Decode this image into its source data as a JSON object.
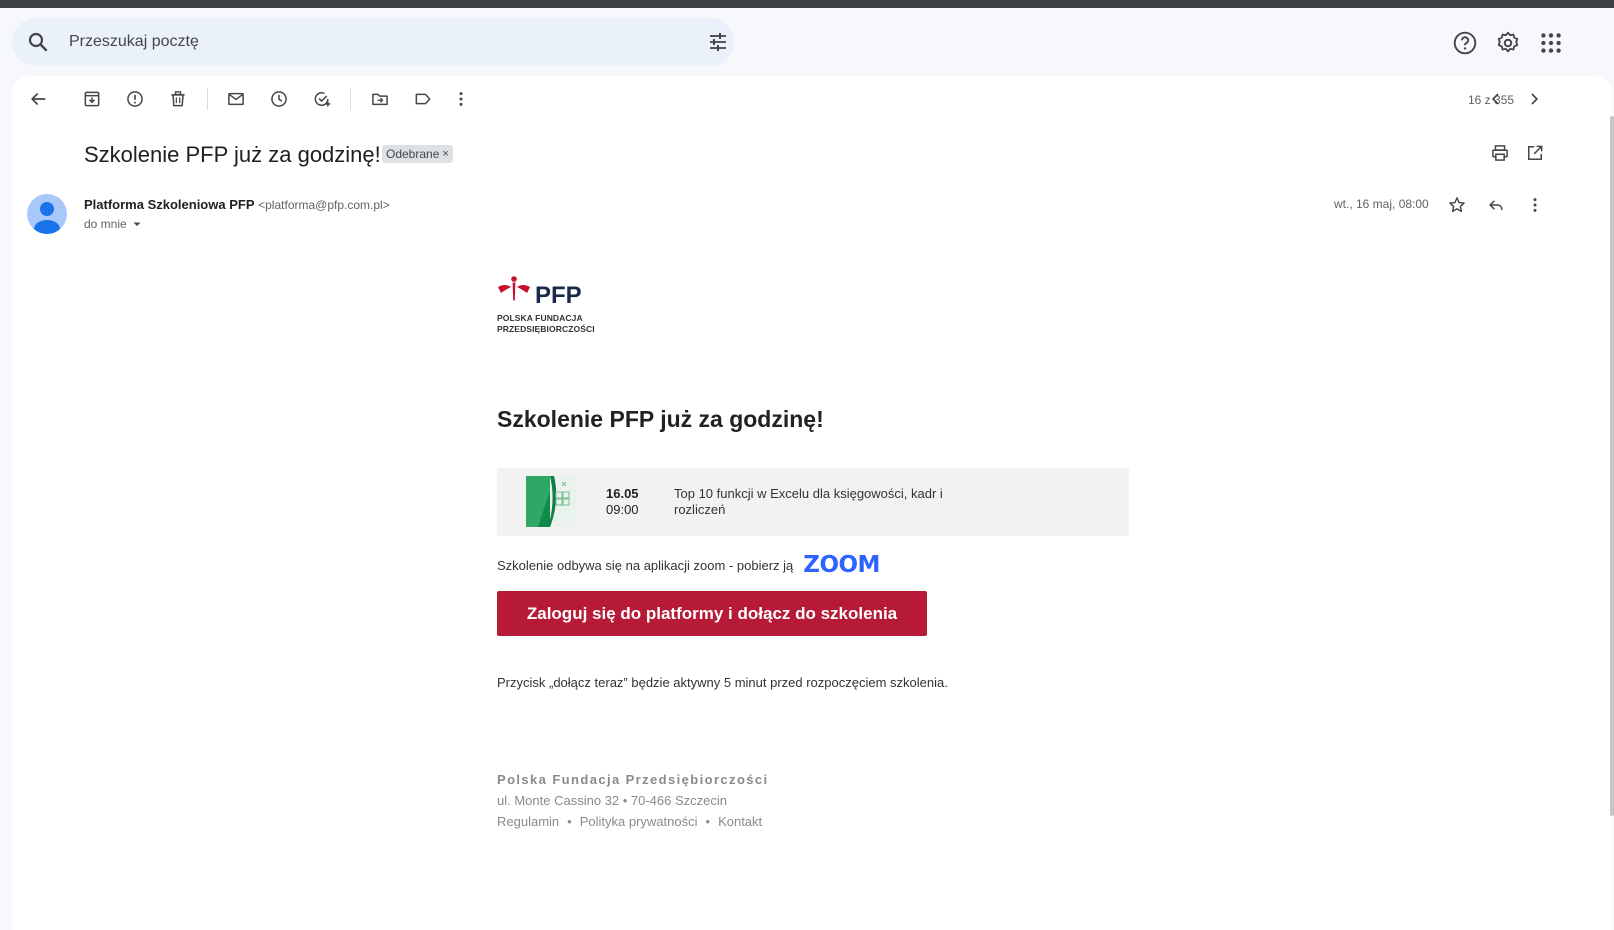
{
  "search": {
    "placeholder": "Przeszukaj pocztę"
  },
  "header_icons": [
    "help-icon",
    "settings-icon",
    "apps-grid-icon"
  ],
  "toolbar": {
    "icons": [
      "back-arrow-icon",
      "archive-icon",
      "report-spam-icon",
      "delete-icon",
      "mark-unread-icon",
      "snooze-icon",
      "add-to-tasks-icon",
      "move-to-icon",
      "label-icon",
      "more-vert-icon"
    ],
    "counter": "16 z 355"
  },
  "message": {
    "subject": "Szkolenie PFP już za godzinę!",
    "label": "Odebrane",
    "label_close": "×",
    "sender_name": "Platforma Szkoleniowa PFP",
    "sender_email": "<platforma@pfp.com.pl>",
    "to": "do mnie",
    "date": "wt., 16 maj, 08:00"
  },
  "email_body": {
    "logo_text": "PFP",
    "logo_line1": "POLSKA FUNDACJA",
    "logo_line2": "PRZEDSIĘBIORCZOŚCI",
    "heading": "Szkolenie PFP już za godzinę!",
    "event_date": "16.05",
    "event_time": "09:00",
    "event_title": "Top 10 funkcji w Excelu dla księgowości, kadr i rozliczeń",
    "zoom_text": "Szkolenie odbywa się na aplikacji zoom - pobierz ją",
    "zoom_logo": "ZOOM",
    "cta": "Zaloguj się do platformy i dołącz do szkolenia",
    "note": "Przycisk „dołącz teraz” będzie aktywny 5 minut przed rozpoczęciem szkolenia.",
    "footer_org": "Polska Fundacja Przedsiębiorczości",
    "footer_address": "ul. Monte Cassino 32 • 70-466 Szczecin",
    "footer_links": [
      "Regulamin",
      "Polityka prywatności",
      "Kontakt"
    ],
    "footer_sep": "•"
  },
  "colors": {
    "cta": "#b61a36",
    "zoom": "#2d64ff",
    "logo_red": "#c8102e",
    "logo_navy": "#1b2a4a"
  }
}
